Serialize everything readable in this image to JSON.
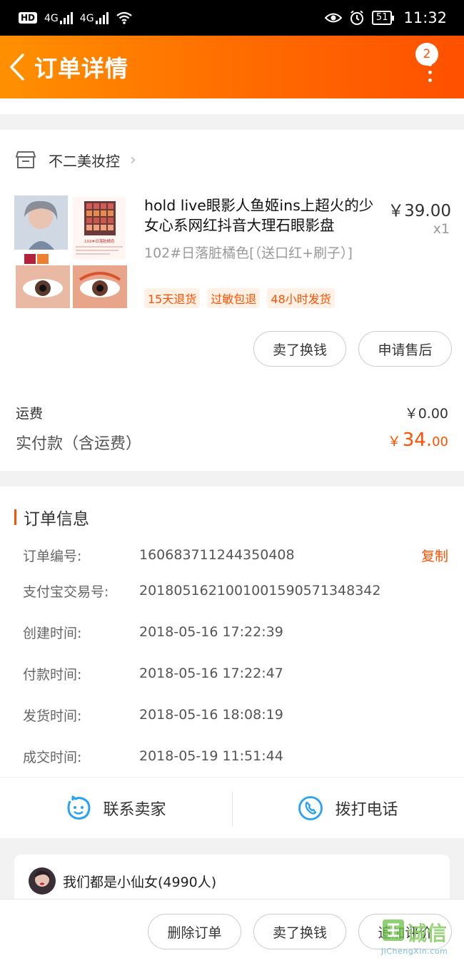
{
  "status_bar": {
    "hd": "HD",
    "net1": "4G",
    "net2": "4G",
    "battery": "51",
    "time": "11:32"
  },
  "nav": {
    "title": "订单详情",
    "badge_count": "2"
  },
  "shop": {
    "name": "不二美妆控"
  },
  "item": {
    "title": "hold live眼影人鱼姬ins上超火的少女心系网红抖音大理石眼影盘",
    "price": "￥39.00",
    "qty": "x1",
    "spec": "102#日落脏橘色[（送口红+刷子）]",
    "tags": [
      "15天退货",
      "过敏包退",
      "48小时发货"
    ],
    "thumb_caption": "102#日落脏橘色",
    "actions": {
      "sell": "卖了换钱",
      "after_sale": "申请售后"
    }
  },
  "payment": {
    "shipping_label": "运费",
    "shipping_value": "￥0.00",
    "paid_label": "实付款（含运费）",
    "paid_symbol": "￥",
    "paid_int": "34.",
    "paid_dec": "00"
  },
  "order_info": {
    "heading": "订单信息",
    "copy_label": "复制",
    "rows": [
      {
        "k": "订单编号:",
        "v": "160683711244350408"
      },
      {
        "k": "支付宝交易号:",
        "v": "2018051621001001590571348342"
      },
      {
        "k": "创建时间:",
        "v": "2018-05-16 17:22:39"
      },
      {
        "k": "付款时间:",
        "v": "2018-05-16 17:22:47"
      },
      {
        "k": "发货时间:",
        "v": "2018-05-16 18:08:19"
      },
      {
        "k": "成交时间:",
        "v": "2018-05-19 11:51:44"
      }
    ]
  },
  "contact": {
    "seller": "联系卖家",
    "call": "拨打电话"
  },
  "group": {
    "name": "我们都是小仙女(4990人)"
  },
  "bottom_actions": {
    "delete": "删除订单",
    "sell": "卖了换钱",
    "review": "追加评价"
  },
  "watermark": {
    "text": "诚信",
    "url": "JiChengXin.com"
  },
  "colors": {
    "accent": "#ff5000",
    "nav_start": "#ff9000",
    "nav_end": "#ff5000",
    "contact_icon": "#29a1f7",
    "tag_bg": "#fff1e6"
  }
}
